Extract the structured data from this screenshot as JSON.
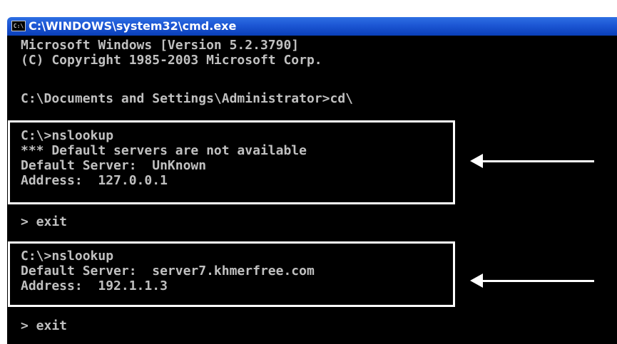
{
  "window": {
    "title": "C:\\WINDOWS\\system32\\cmd.exe",
    "icon": "cmd-icon",
    "icon_glyph": "C:\\"
  },
  "console": {
    "lines": [
      "Microsoft Windows [Version 5.2.3790]",
      "(C) Copyright 1985-2003 Microsoft Corp.",
      "C:\\Documents and Settings\\Administrator>cd\\",
      "C:\\>nslookup",
      "*** Default servers are not available",
      "Default Server:  UnKnown",
      "Address:  127.0.0.1",
      "> exit",
      "C:\\>nslookup",
      "Default Server:  server7.khmerfree.com",
      "Address:  192.1.1.3",
      "> exit"
    ]
  },
  "annotations": {
    "box_color": "#ffffff",
    "arrow_color": "#ffffff"
  },
  "colors": {
    "console_bg": "#000000",
    "console_text": "#c0c0c0",
    "titlebar": "#1c56d4"
  }
}
